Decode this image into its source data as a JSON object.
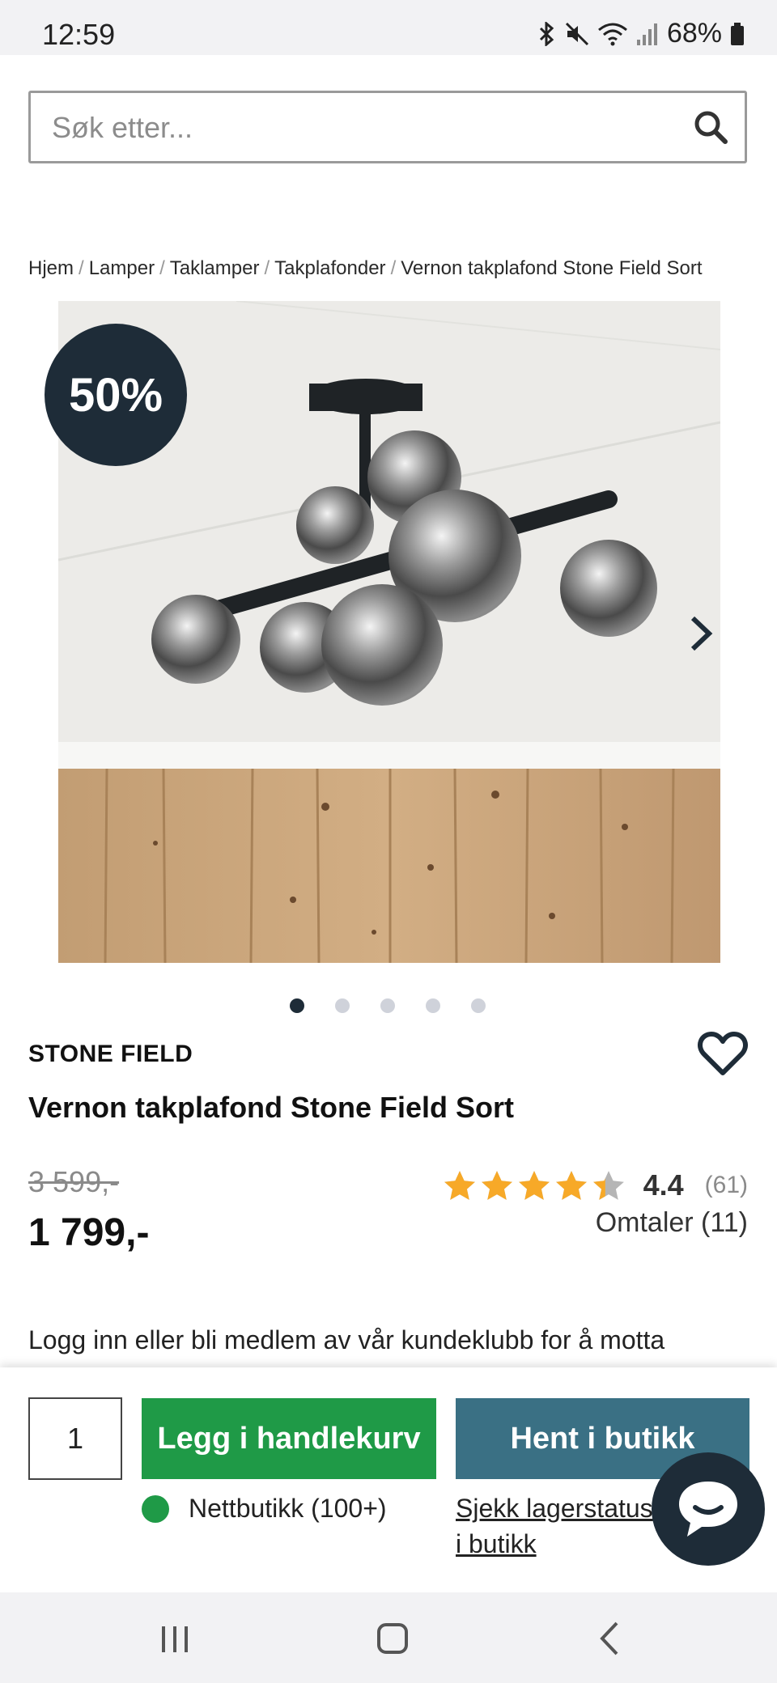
{
  "status_bar": {
    "time": "12:59",
    "battery": "68%"
  },
  "search": {
    "placeholder": "Søk etter..."
  },
  "breadcrumb": [
    "Hjem",
    "Lamper",
    "Taklamper",
    "Takplafonder",
    "Vernon takplafond Stone Field Sort"
  ],
  "product": {
    "discount_badge": "50%",
    "brand": "STONE FIELD",
    "title": "Vernon takplafond Stone Field Sort",
    "old_price": "3 599,-",
    "price": "1 799,-",
    "rating_value": "4.4",
    "rating_stars": 4.4,
    "rating_count": "(61)",
    "reviews_link": "Omtaler (11)",
    "gallery_images": 5,
    "gallery_active_index": 0
  },
  "member_text": "Logg inn eller bli medlem av vår kundeklubb for å motta eksklusive kundeklubbtilbud",
  "purchase": {
    "quantity": "1",
    "add_to_cart": "Legg i handlekurv",
    "pickup": "Hent i butikk",
    "stock_label": "Nettbutikk (100+)",
    "check_stock_link": "Sjekk lagerstatus i butikk"
  },
  "colors": {
    "dark_navy": "#1e2c38",
    "green": "#1f9a47",
    "teal": "#3a7084",
    "star": "#f7a928"
  },
  "icons": [
    "search-icon",
    "heart-icon",
    "chevron-right-icon",
    "chat-icon",
    "recent-apps-icon",
    "home-icon",
    "back-icon"
  ]
}
